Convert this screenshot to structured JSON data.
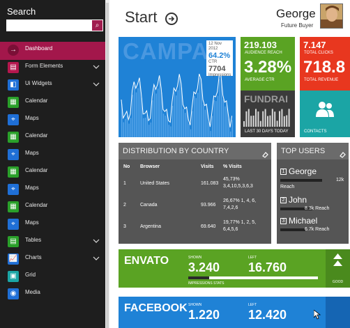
{
  "sidebar": {
    "search_title": "Search",
    "search_value": "",
    "items": [
      {
        "label": "Dashboard",
        "icon": "dashboard-icon",
        "color": "#a3174b",
        "glyph": "→"
      },
      {
        "label": "Form Elements",
        "icon": "form-icon",
        "color": "#b5174e",
        "glyph": "▤"
      },
      {
        "label": "Ui Widgets",
        "icon": "widgets-icon",
        "color": "#1f6fd6",
        "glyph": "◧"
      },
      {
        "label": "Calendar",
        "icon": "calendar-icon",
        "color": "#2aa02a",
        "glyph": "▦"
      },
      {
        "label": "Maps",
        "icon": "map-icon",
        "color": "#1f6fd6",
        "glyph": "⌖"
      },
      {
        "label": "Calendar",
        "icon": "calendar-icon",
        "color": "#2aa02a",
        "glyph": "▦"
      },
      {
        "label": "Maps",
        "icon": "map-icon",
        "color": "#1f6fd6",
        "glyph": "⌖"
      },
      {
        "label": "Calendar",
        "icon": "calendar-icon",
        "color": "#2aa02a",
        "glyph": "▦"
      },
      {
        "label": "Maps",
        "icon": "map-icon",
        "color": "#1f6fd6",
        "glyph": "⌖"
      },
      {
        "label": "Calendar",
        "icon": "calendar-icon",
        "color": "#2aa02a",
        "glyph": "▦"
      },
      {
        "label": "Maps",
        "icon": "map-icon",
        "color": "#1f6fd6",
        "glyph": "⌖"
      },
      {
        "label": "Tables",
        "icon": "table-icon",
        "color": "#2aa02a",
        "glyph": "▤"
      },
      {
        "label": "Charts",
        "icon": "chart-icon",
        "color": "#1f6fd6",
        "glyph": "📈"
      },
      {
        "label": "Grid",
        "icon": "grid-icon",
        "color": "#1ba5a5",
        "glyph": "▣"
      },
      {
        "label": "Media",
        "icon": "media-icon",
        "color": "#1f6fd6",
        "glyph": "◉"
      }
    ]
  },
  "header": {
    "title": "Start",
    "user_name": "George",
    "user_role": "Future Buyer"
  },
  "tiles": {
    "campaign": {
      "bg_word": "CAMPA",
      "date": "12 Nov 2012",
      "ctr_value": "64.2%",
      "ctr_label": "CTR",
      "impressions_value": "7704",
      "impressions_label": "Impressions"
    },
    "audience": {
      "value": "219.103",
      "label": "AUDIENCE REACH",
      "big": "3.28%",
      "big_label": "AVERAGE CTR"
    },
    "clicks": {
      "value": "7.147",
      "label": "TOTAL CLICKS",
      "big": "718.8",
      "big_label": "TOTAL REVENUE"
    },
    "fundraising": {
      "bg_word": "FUNDRAI",
      "label": "LAST 30 DAYS TODAY"
    },
    "contacts": {
      "label": "CONTACTS"
    }
  },
  "distribution": {
    "title": "DISTRIBUTION BY COUNTRY",
    "columns": [
      "No",
      "Browser",
      "Visits",
      "% Visits"
    ],
    "rows": [
      {
        "no": "1",
        "browser": "United States",
        "visits": "161.083",
        "pct1": "45,73%",
        "pct2": "3,4,10,5,3,6,3"
      },
      {
        "no": "2",
        "browser": "Canada",
        "visits": "93.966",
        "pct1": "26,67% 1, 4, 6,",
        "pct2": "7,4,2,6"
      },
      {
        "no": "3",
        "browser": "Argentina",
        "visits": "69.640",
        "pct1": "19,77% 1, 2, 5,",
        "pct2": "6,4,5,6"
      }
    ]
  },
  "top_users": {
    "title": "TOP USERS",
    "users": [
      {
        "rank": "1",
        "name": "George",
        "reach": "12k",
        "reach_label": "Reach",
        "share": 0.75
      },
      {
        "rank": "2",
        "name": "John",
        "reach": "8.3k Reach",
        "share": 0.57
      },
      {
        "rank": "3",
        "name": "Michael",
        "reach": "6.7k Reach",
        "share": 0.45
      }
    ]
  },
  "envato": {
    "name": "ENVATO",
    "shown_label": "SHOWN",
    "shown": "3.240",
    "left_label": "LEFT",
    "left": "16.760",
    "stats_label": "IMPRESSIONS STATS",
    "good": "GOOD",
    "shown_share": 0.16
  },
  "facebook": {
    "name": "FACEBOOK",
    "shown_label": "SHOWN",
    "shown": "1.220",
    "left_label": "LEFT",
    "left": "12.420"
  }
}
